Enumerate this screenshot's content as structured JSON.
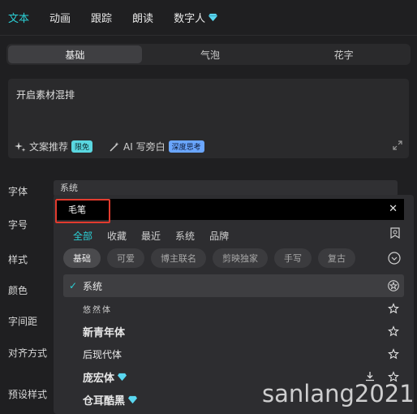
{
  "top_tabs": [
    {
      "label": "文本",
      "active": true
    },
    {
      "label": "动画"
    },
    {
      "label": "跟踪"
    },
    {
      "label": "朗读"
    },
    {
      "label": "数字人",
      "icon": "diamond-icon"
    }
  ],
  "sub_tabs": [
    "基础",
    "气泡",
    "花字"
  ],
  "textbox": {
    "content": "开启素材混排",
    "actions": [
      {
        "label": "文案推荐",
        "badge": "限免",
        "icon": "sparkle-icon"
      },
      {
        "label": "AI 写旁白",
        "badge": "深度思考",
        "icon": "magic-wand-icon"
      }
    ]
  },
  "labels": {
    "font": "字体",
    "size": "字号",
    "style": "样式",
    "color": "颜色",
    "spacing": "字间距",
    "align": "对齐方式",
    "preset": "预设样式"
  },
  "font_select": {
    "value": "系统"
  },
  "dropdown": {
    "search_value": "毛笔",
    "categories": [
      "全部",
      "收藏",
      "最近",
      "系统",
      "品牌"
    ],
    "chips": [
      "基础",
      "可爱",
      "博主联名",
      "剪映独家",
      "手写",
      "复古"
    ],
    "fonts": [
      {
        "name": "系统",
        "selected": true
      },
      {
        "name": "悠然体"
      },
      {
        "name": "新青年体"
      },
      {
        "name": "后现代体"
      },
      {
        "name": "庞宏体",
        "vip": true,
        "download": true
      },
      {
        "name": "仓耳酷黑",
        "vip": true
      }
    ]
  },
  "watermark": "sanlang2021",
  "colors": {
    "accent": "#2bd0d6",
    "highlight": "#e23b2e",
    "diamond": "#5ad7f0"
  }
}
